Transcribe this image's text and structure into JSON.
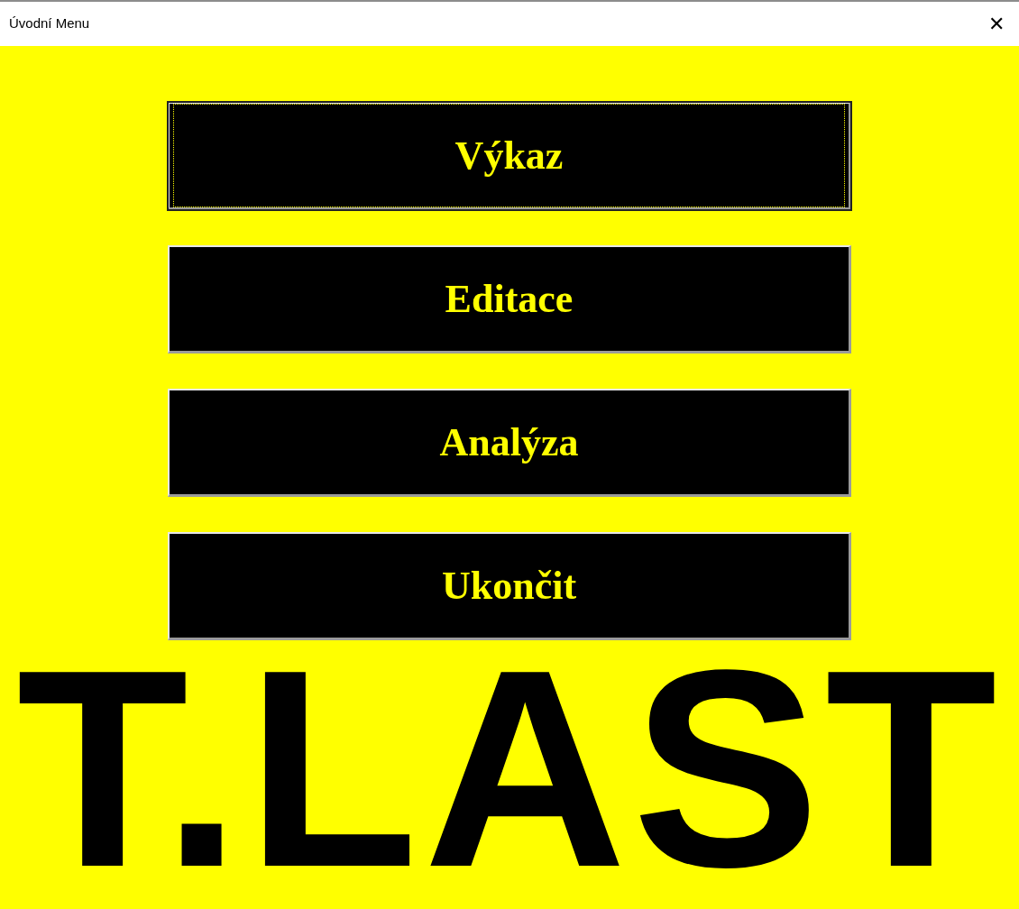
{
  "window": {
    "title": "Úvodní Menu",
    "close": "✕"
  },
  "buttons": [
    {
      "label": "Výkaz",
      "focused": true
    },
    {
      "label": "Editace",
      "focused": false
    },
    {
      "label": "Analýza",
      "focused": false
    },
    {
      "label": "Ukončit",
      "focused": false
    }
  ],
  "logo": "T.LAST"
}
